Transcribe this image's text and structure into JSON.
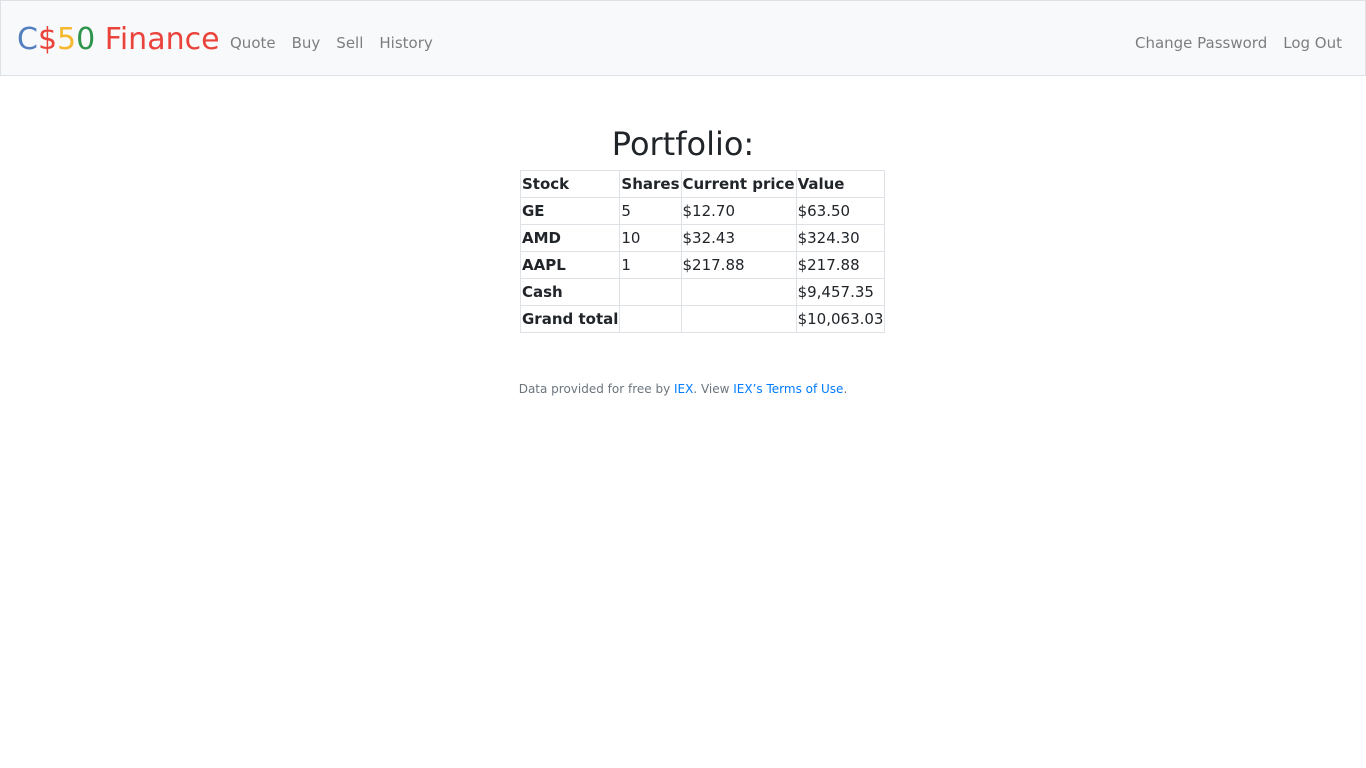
{
  "navbar": {
    "brand": {
      "c": "C",
      "dollar": "$",
      "five": "5",
      "zero": "0",
      "finance": " Finance"
    },
    "left_links": [
      "Quote",
      "Buy",
      "Sell",
      "History"
    ],
    "right_links": [
      "Change Password",
      "Log Out"
    ]
  },
  "main": {
    "title": "Portfolio:",
    "table": {
      "headers": [
        "Stock",
        "Shares",
        "Current price",
        "Value"
      ],
      "rows": [
        [
          "GE",
          "5",
          "$12.70",
          "$63.50"
        ],
        [
          "AMD",
          "10",
          "$32.43",
          "$324.30"
        ],
        [
          "AAPL",
          "1",
          "$217.88",
          "$217.88"
        ],
        [
          "Cash",
          "",
          "",
          "$9,457.35"
        ],
        [
          "Grand total",
          "",
          "",
          "$10,063.03"
        ]
      ]
    }
  },
  "footer": {
    "prefix": "Data provided for free by ",
    "iex_link": "IEX",
    "middle": ". View ",
    "terms_link": "IEX’s Terms of Use",
    "suffix": "."
  },
  "colors": {
    "brand_blue": "#537fbe",
    "brand_red": "#ea433b",
    "brand_yellow": "#f5b82e",
    "brand_green": "#2e944b",
    "link": "#007bff"
  }
}
